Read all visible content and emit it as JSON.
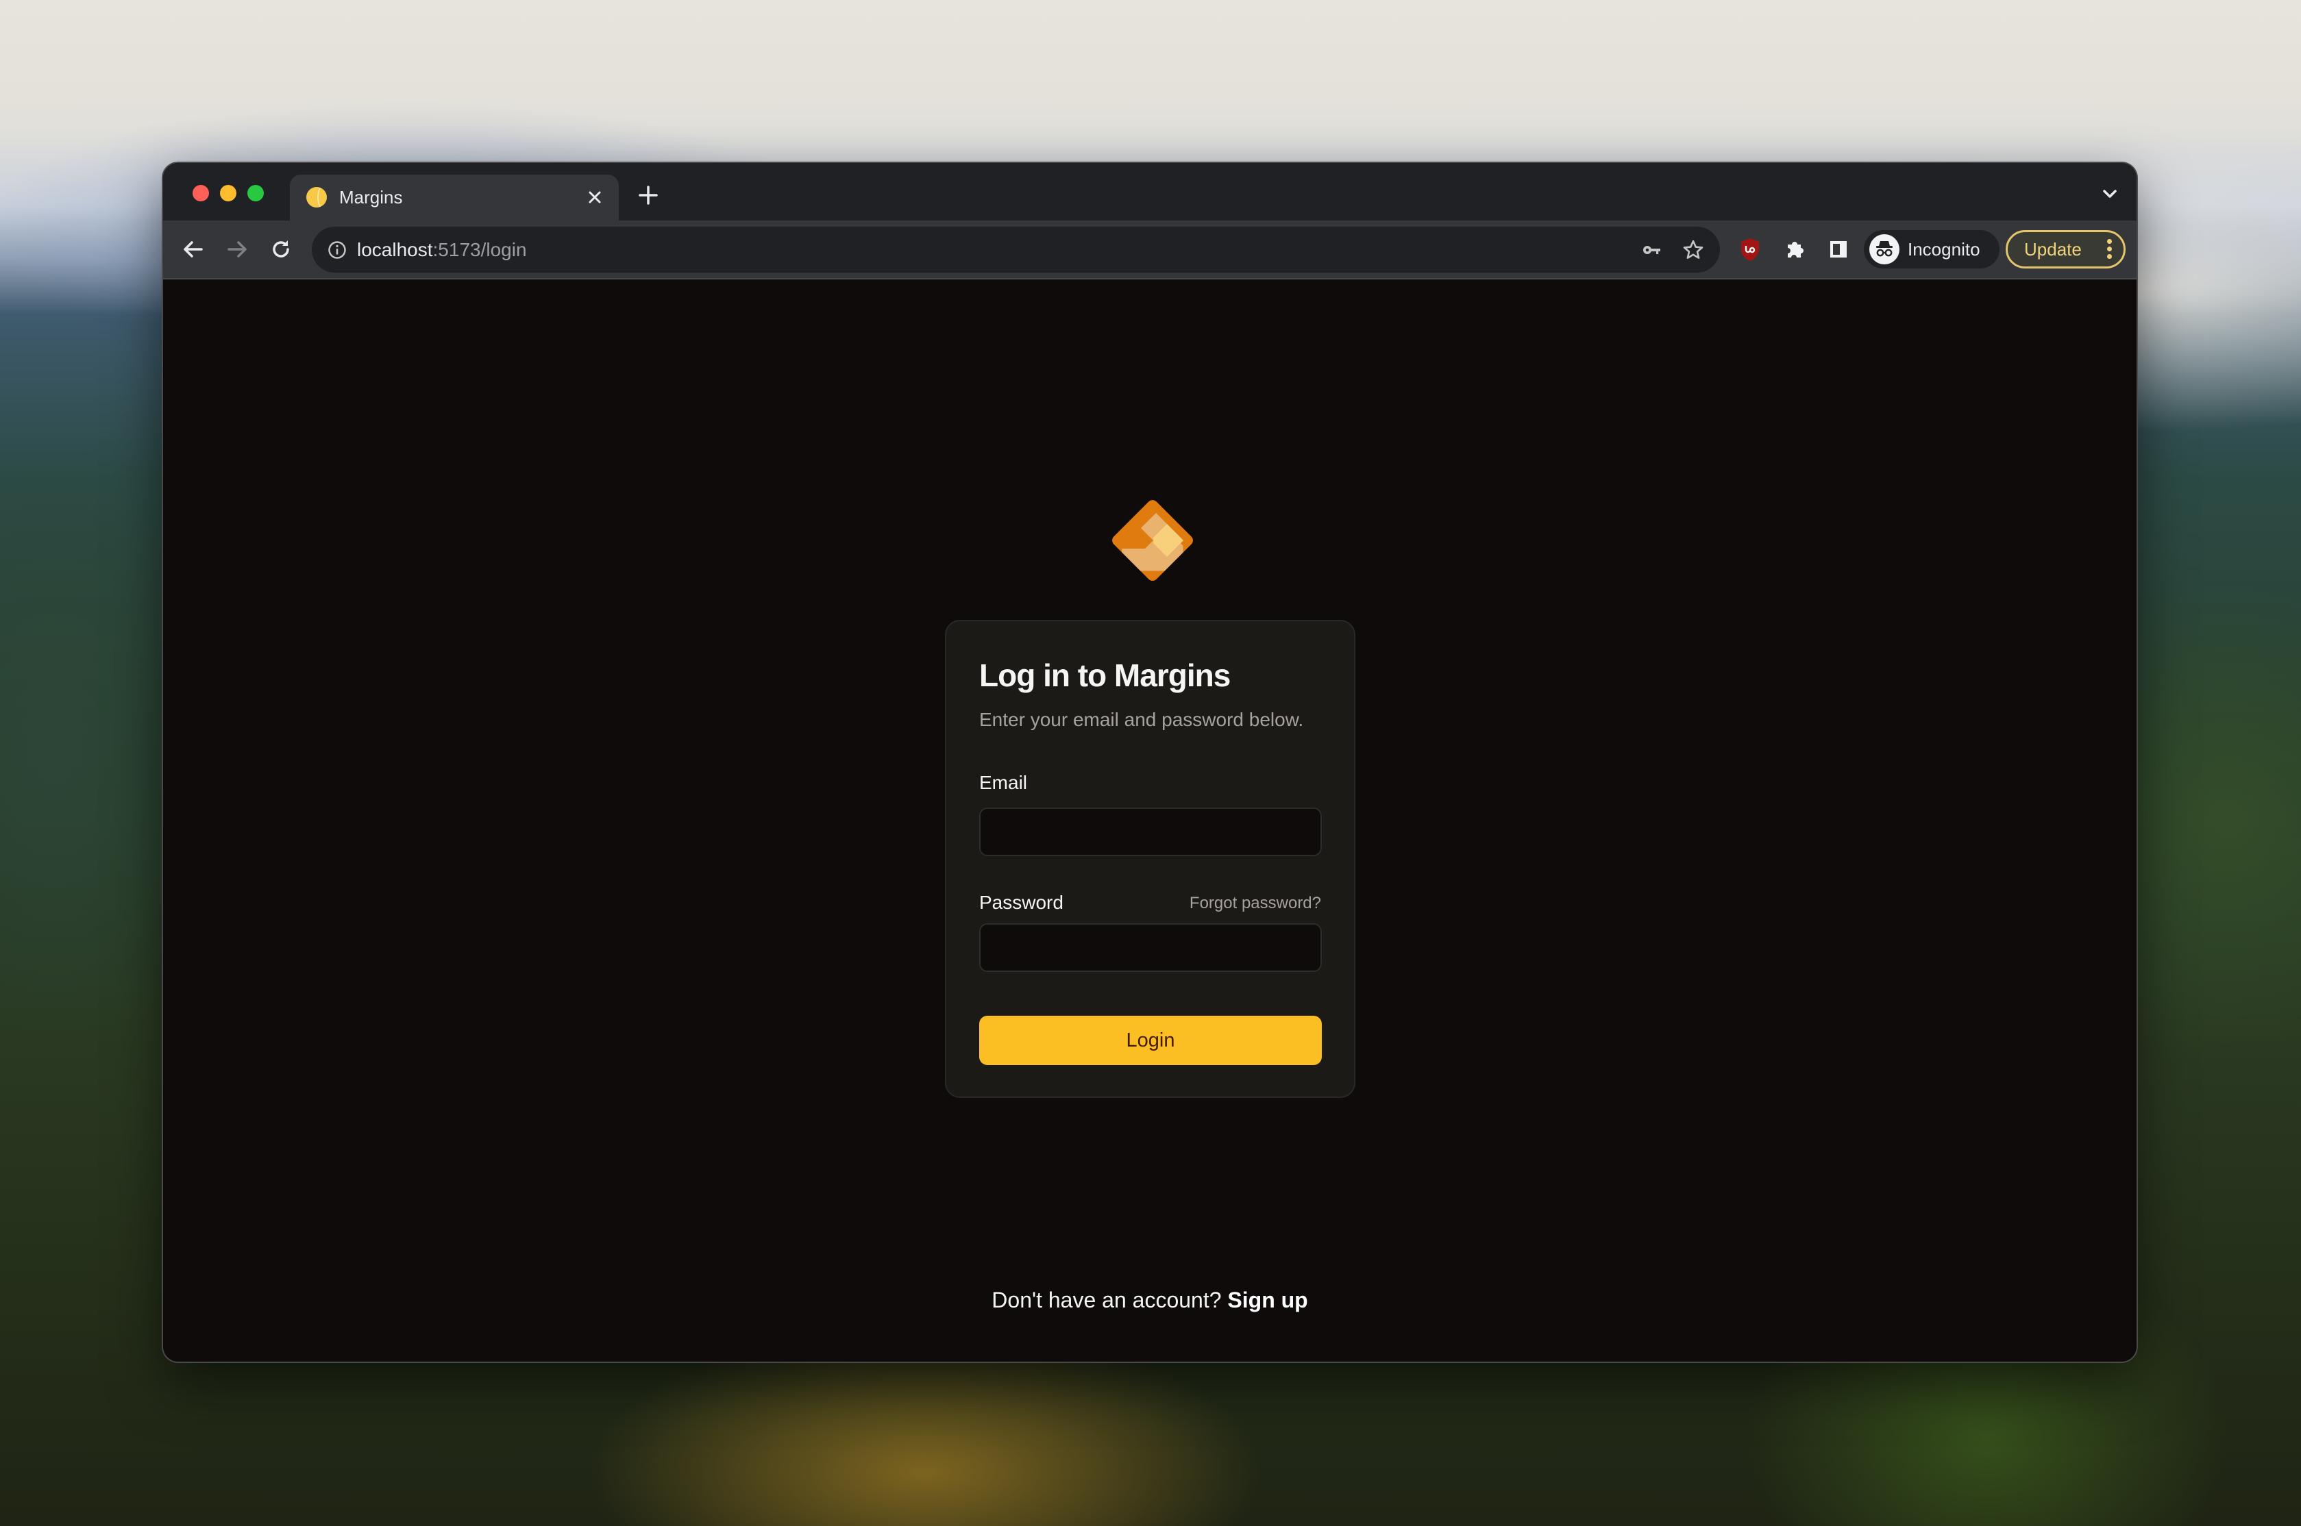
{
  "browser": {
    "tab": {
      "title": "Margins",
      "favicon": "margins-favicon",
      "close_icon": "close-icon"
    },
    "new_tab_icon": "plus-icon",
    "tab_search_icon": "chevron-down-icon",
    "nav": {
      "back_icon": "arrow-left-icon",
      "forward_icon": "arrow-right-icon",
      "reload_icon": "reload-icon"
    },
    "omnibox": {
      "host": "localhost",
      "path": ":5173/login",
      "info_icon": "info-icon",
      "key_icon": "key-icon",
      "star_icon": "star-icon"
    },
    "extensions": [
      "ublock-origin-icon",
      "puzzle-icon",
      "side-panel-icon"
    ],
    "profile": {
      "label": "Incognito",
      "icon": "incognito-icon"
    },
    "update_button": {
      "label": "Update",
      "menu_icon": "kebab-menu-icon"
    }
  },
  "login": {
    "logo_icon": "margins-logo",
    "title": "Log in to Margins",
    "subtitle": "Enter your email and password below.",
    "email_label": "Email",
    "email_value": "",
    "password_label": "Password",
    "password_value": "",
    "forgot_password": "Forgot password?",
    "submit_label": "Login",
    "signup_prompt": "Don't have an account? ",
    "signup_link": "Sign up"
  },
  "colors": {
    "accent": "#fbbf24",
    "accent_text": "#451a03",
    "page_bg": "#0e0b0a",
    "card_bg": "#1c1a17",
    "logo_dark": "#e07b0f",
    "logo_mid": "#e9b36f",
    "logo_light": "#f8cf7a",
    "update_border": "#e4c56b"
  }
}
